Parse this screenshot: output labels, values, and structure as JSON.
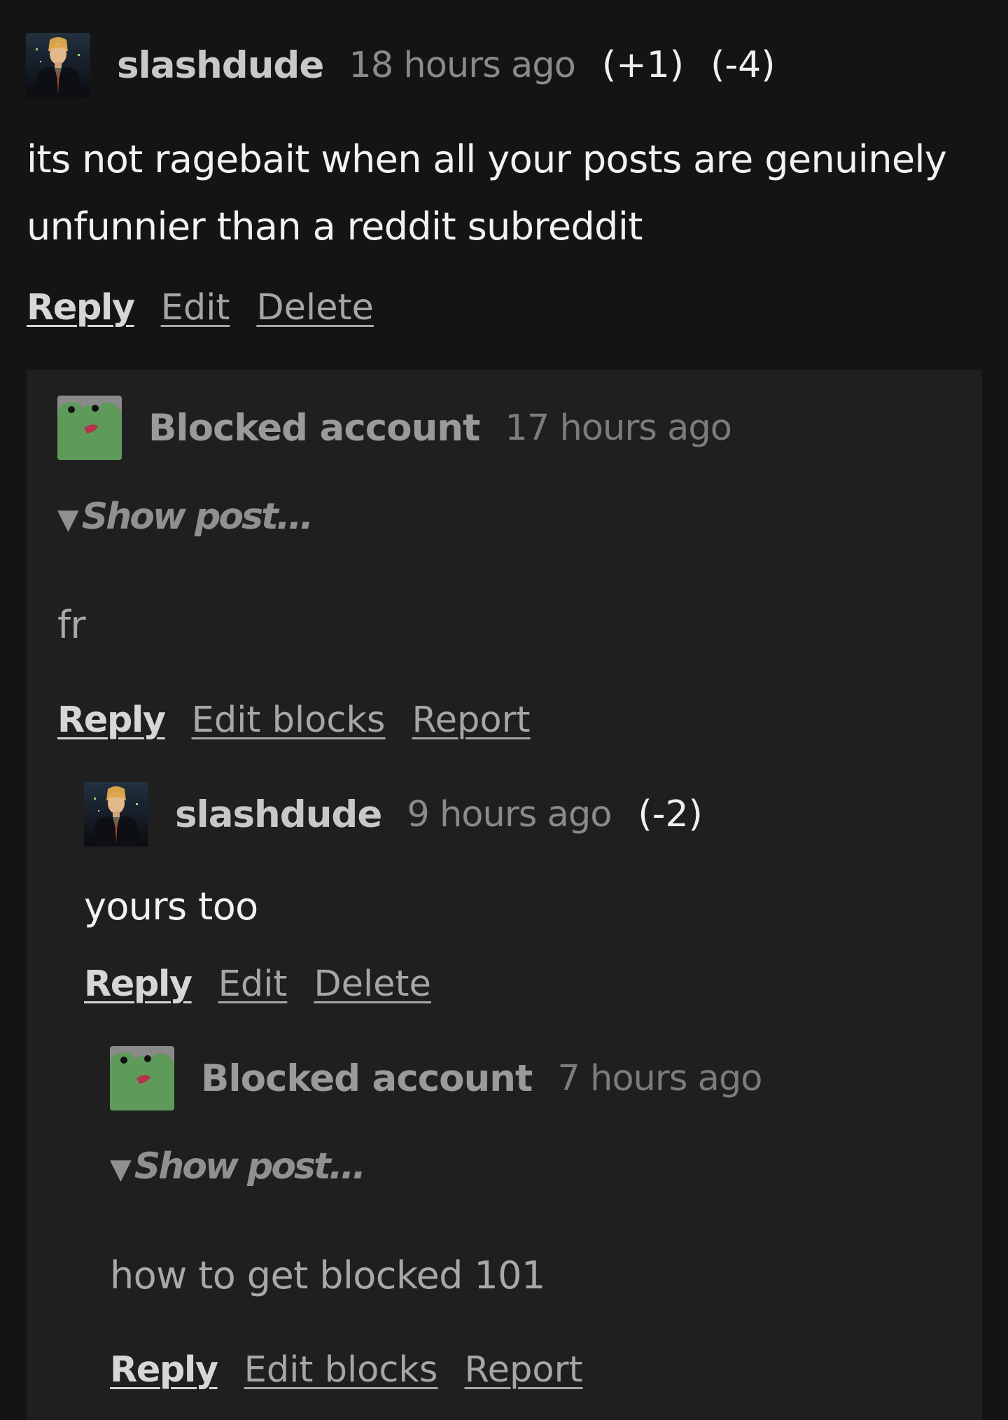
{
  "comments": [
    {
      "username": "slashdude",
      "time": "18 hours ago",
      "score_up": "(+1)",
      "score_down": "(-4)",
      "body_line1": "its not ragebait when all your posts are genuinely",
      "body_line2": "unfunnier than a reddit subreddit",
      "actions": {
        "reply": "Reply",
        "edit": "Edit",
        "delete": "Delete"
      }
    },
    {
      "username": "Blocked account",
      "time": "17 hours ago",
      "show_post": "Show post...",
      "body": "fr",
      "actions": {
        "reply": "Reply",
        "edit_blocks": "Edit blocks",
        "report": "Report"
      }
    },
    {
      "username": "slashdude",
      "time": "9 hours ago",
      "score_down": "(-2)",
      "body": "yours too",
      "actions": {
        "reply": "Reply",
        "edit": "Edit",
        "delete": "Delete"
      }
    },
    {
      "username": "Blocked account",
      "time": "7 hours ago",
      "show_post": "Show post...",
      "body": "how to get blocked 101",
      "actions": {
        "reply": "Reply",
        "edit_blocks": "Edit blocks",
        "report": "Report"
      }
    }
  ],
  "icons": {
    "disclosure": "▼",
    "avatar_user": "slashdude-avatar",
    "avatar_blocked": "frog-avatar"
  },
  "colors": {
    "background": "#141414",
    "reply_panel": "#1f1f1f",
    "blocked_avatar": "#5e9a5a"
  }
}
